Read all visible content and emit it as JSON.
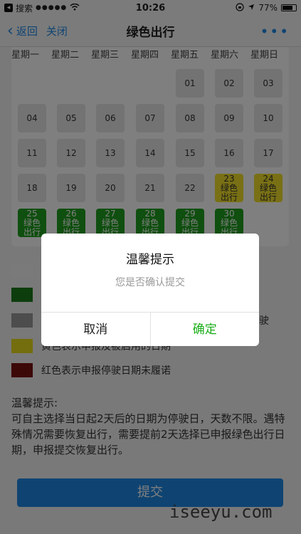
{
  "status_bar": {
    "carrier": "搜索",
    "signal": "●●●●●",
    "time": "10:26",
    "battery_text": "77%",
    "battery_level": 0.77
  },
  "nav": {
    "back_label": "返回",
    "close_label": "关闭",
    "title": "绿色出行",
    "more": "•••"
  },
  "calendar": {
    "weekdays": [
      "星期一",
      "星期二",
      "星期三",
      "星期四",
      "星期五",
      "星期六",
      "星期日"
    ],
    "days": [
      {
        "day": "01",
        "status": "default"
      },
      {
        "day": "02",
        "status": "default"
      },
      {
        "day": "03",
        "status": "default"
      },
      {
        "day": "04",
        "status": "default"
      },
      {
        "day": "05",
        "status": "default"
      },
      {
        "day": "06",
        "status": "default"
      },
      {
        "day": "07",
        "status": "default"
      },
      {
        "day": "08",
        "status": "default"
      },
      {
        "day": "09",
        "status": "default"
      },
      {
        "day": "10",
        "status": "default"
      },
      {
        "day": "11",
        "status": "default"
      },
      {
        "day": "12",
        "status": "default"
      },
      {
        "day": "13",
        "status": "default"
      },
      {
        "day": "14",
        "status": "default"
      },
      {
        "day": "15",
        "status": "default"
      },
      {
        "day": "16",
        "status": "default"
      },
      {
        "day": "17",
        "status": "default"
      },
      {
        "day": "18",
        "status": "default"
      },
      {
        "day": "19",
        "status": "default"
      },
      {
        "day": "20",
        "status": "default"
      },
      {
        "day": "21",
        "status": "default"
      },
      {
        "day": "22",
        "status": "default"
      },
      {
        "day": "23",
        "status": "yellow",
        "l1": "绿色",
        "l2": "出行"
      },
      {
        "day": "24",
        "status": "yellow",
        "l1": "绿色",
        "l2": "出行"
      },
      {
        "day": "25",
        "status": "green",
        "l1": "绿色",
        "l2": "出行"
      },
      {
        "day": "26",
        "status": "green",
        "l1": "绿色",
        "l2": "出行"
      },
      {
        "day": "27",
        "status": "green",
        "l1": "绿色",
        "l2": "出行"
      },
      {
        "day": "28",
        "status": "green",
        "l1": "绿色",
        "l2": "出行"
      },
      {
        "day": "29",
        "status": "green",
        "l1": "绿色",
        "l2": "出行"
      },
      {
        "day": "30",
        "status": "green",
        "l1": "绿色",
        "l2": "出行"
      }
    ]
  },
  "legend": [
    {
      "color": "#f5f5f5",
      "text": ""
    },
    {
      "color": "#1a7a1a",
      "text": ""
    },
    {
      "color": "#9a9a9a",
      "text": "驶"
    },
    {
      "color": "#e8dc1c",
      "text": "黄色表示申报及被启用的日期"
    },
    {
      "color": "#7a1010",
      "text": "红色表示申报停驶日期未履诺"
    }
  ],
  "tips": {
    "title": "温馨提示:",
    "body": "可自主选择当日起2天后的日期为停驶日，天数不限。遇特殊情况需要恢复出行，需要提前2天选择已申报绿色出行日期，申报提交恢复出行。"
  },
  "submit_label": "提交",
  "dialog": {
    "title": "温馨提示",
    "message": "您是否确认提交",
    "cancel_label": "取消",
    "confirm_label": "确定"
  },
  "colors": {
    "accent": "#1e88e5",
    "green": "#1f9e1f",
    "yellow": "#f2e12a",
    "confirm": "#1aad19"
  },
  "watermark": "iseeyu.com"
}
